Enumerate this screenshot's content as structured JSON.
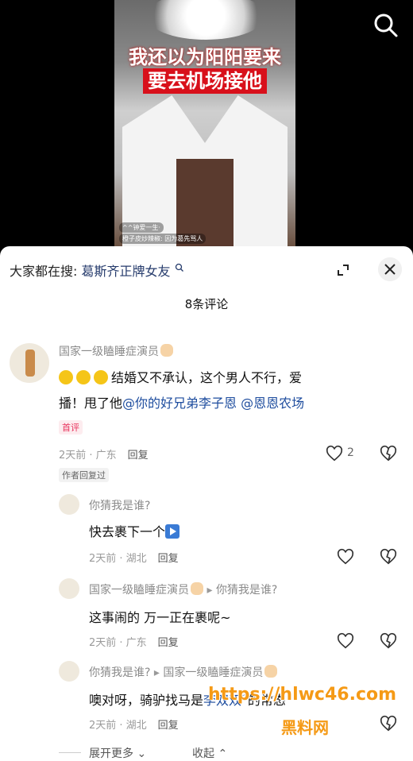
{
  "video": {
    "caption_line1": "我还以为阳阳要来",
    "caption_line2": "要去机场接他",
    "live_comments": [
      "^^钟爱一生·",
      "橙子皮炒辣椒: 因为葛先骂人"
    ]
  },
  "search_bar": {
    "prefix": "大家都在搜:",
    "term": "葛斯齐正牌女友"
  },
  "comment_count": "8条评论",
  "comments": [
    {
      "user": "国家一级瞌睡症演员",
      "text_plain": "结婚又不承认，这个男人不行，爱",
      "text_line2": "播！甩了他",
      "mention1": "@你的好兄弟李子恩",
      "mention2": "@恩恩农场",
      "badge_hot": "首评",
      "time_loc": "2天前 · 广东",
      "reply": "回复",
      "likes": "2",
      "badge_author": "作者回复过"
    }
  ],
  "replies": [
    {
      "user": "你猜我是谁?",
      "text": "快去裹下一个",
      "time_loc": "2天前 · 湖北",
      "reply": "回复"
    },
    {
      "user": "国家一级瞌睡症演员",
      "reply_to": "你猜我是谁?",
      "text": "这事闹的  万一正在裹呢~",
      "time_loc": "2天前 · 广东",
      "reply": "回复"
    },
    {
      "user": "你猜我是谁?",
      "reply_to": "国家一级瞌睡症演员",
      "text_a": "噢对呀，骑驴找马是",
      "text_b": "李双双",
      "text_c": "的常态",
      "time_loc": "2天前 · 湖北",
      "reply": "回复"
    }
  ],
  "expand_more": "展开更多",
  "collapse": "收起",
  "watermark": {
    "line1": "https://hlwc46.com",
    "line2": "黑料网"
  },
  "colors": {
    "mention": "#1d4c9e",
    "hot_badge": "#e8335d",
    "watermark": "#f59a16"
  }
}
